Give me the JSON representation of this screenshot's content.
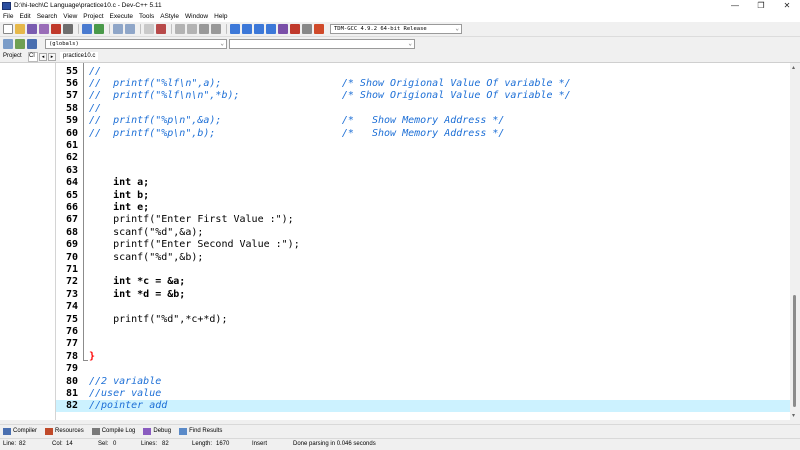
{
  "window": {
    "title": "D:\\hi-tech\\C Language\\practice10.c - Dev-C++ 5.11",
    "minimize": "—",
    "maximize": "❐",
    "close": "✕"
  },
  "menu": [
    "File",
    "Edit",
    "Search",
    "View",
    "Project",
    "Execute",
    "Tools",
    "AStyle",
    "Window",
    "Help"
  ],
  "toolbar": {
    "compiler_select": "TDM-GCC 4.9.2 64-bit Release",
    "globals_select": "(globals)",
    "second_select": ""
  },
  "tabs": {
    "project_tab": "Project",
    "classes_tab": "Cl",
    "prev_arrow": "◂",
    "next_arrow": "▸",
    "file_tab": "practice10.c"
  },
  "editor": {
    "lines": [
      {
        "n": "55",
        "text": "//"
      },
      {
        "n": "56",
        "text": "//  printf(\"%lf\\n\",a);                    /* Show Origional Value Of variable */"
      },
      {
        "n": "57",
        "text": "//  printf(\"%lf\\n\\n\",*b);                 /* Show Origional Value Of variable */"
      },
      {
        "n": "58",
        "text": "//"
      },
      {
        "n": "59",
        "text": "//  printf(\"%p\\n\",&a);                    /*   Show Memory Address */"
      },
      {
        "n": "60",
        "text": "//  printf(\"%p\\n\",b);                     /*   Show Memory Address */"
      },
      {
        "n": "61",
        "text": ""
      },
      {
        "n": "62",
        "text": ""
      },
      {
        "n": "63",
        "text": ""
      },
      {
        "n": "64",
        "text": "    int a;"
      },
      {
        "n": "65",
        "text": "    int b;"
      },
      {
        "n": "66",
        "text": "    int e;"
      },
      {
        "n": "67",
        "text": "    printf(\"Enter First Value :\");"
      },
      {
        "n": "68",
        "text": "    scanf(\"%d\",&a);"
      },
      {
        "n": "69",
        "text": "    printf(\"Enter Second Value :\");"
      },
      {
        "n": "70",
        "text": "    scanf(\"%d\",&b);"
      },
      {
        "n": "71",
        "text": ""
      },
      {
        "n": "72",
        "text": "    int *c = &a;"
      },
      {
        "n": "73",
        "text": "    int *d = &b;"
      },
      {
        "n": "74",
        "text": ""
      },
      {
        "n": "75",
        "text": "    printf(\"%d\",*c+*d);"
      },
      {
        "n": "76",
        "text": ""
      },
      {
        "n": "77",
        "text": ""
      },
      {
        "n": "78",
        "text": "}"
      },
      {
        "n": "79",
        "text": ""
      },
      {
        "n": "80",
        "text": "//2 variable"
      },
      {
        "n": "81",
        "text": "//user value"
      },
      {
        "n": "82",
        "text": "//pointer add"
      }
    ]
  },
  "bottom_tabs": [
    "Compiler",
    "Resources",
    "Compile Log",
    "Debug",
    "Find Results"
  ],
  "status": {
    "line_label": "Line:",
    "line_value": "82",
    "col_label": "Col:",
    "col_value": "14",
    "sel_label": "Sel:",
    "sel_value": "0",
    "lines_label": "Lines:",
    "lines_value": "82",
    "length_label": "Length:",
    "length_value": "1670",
    "mode": "Insert",
    "message": "Done parsing in 0.046 seconds"
  },
  "colors": {
    "comment": "#1d6fd6",
    "string": "#0000ff",
    "operator": "#ff0000",
    "current_line": "#ccf2ff"
  }
}
